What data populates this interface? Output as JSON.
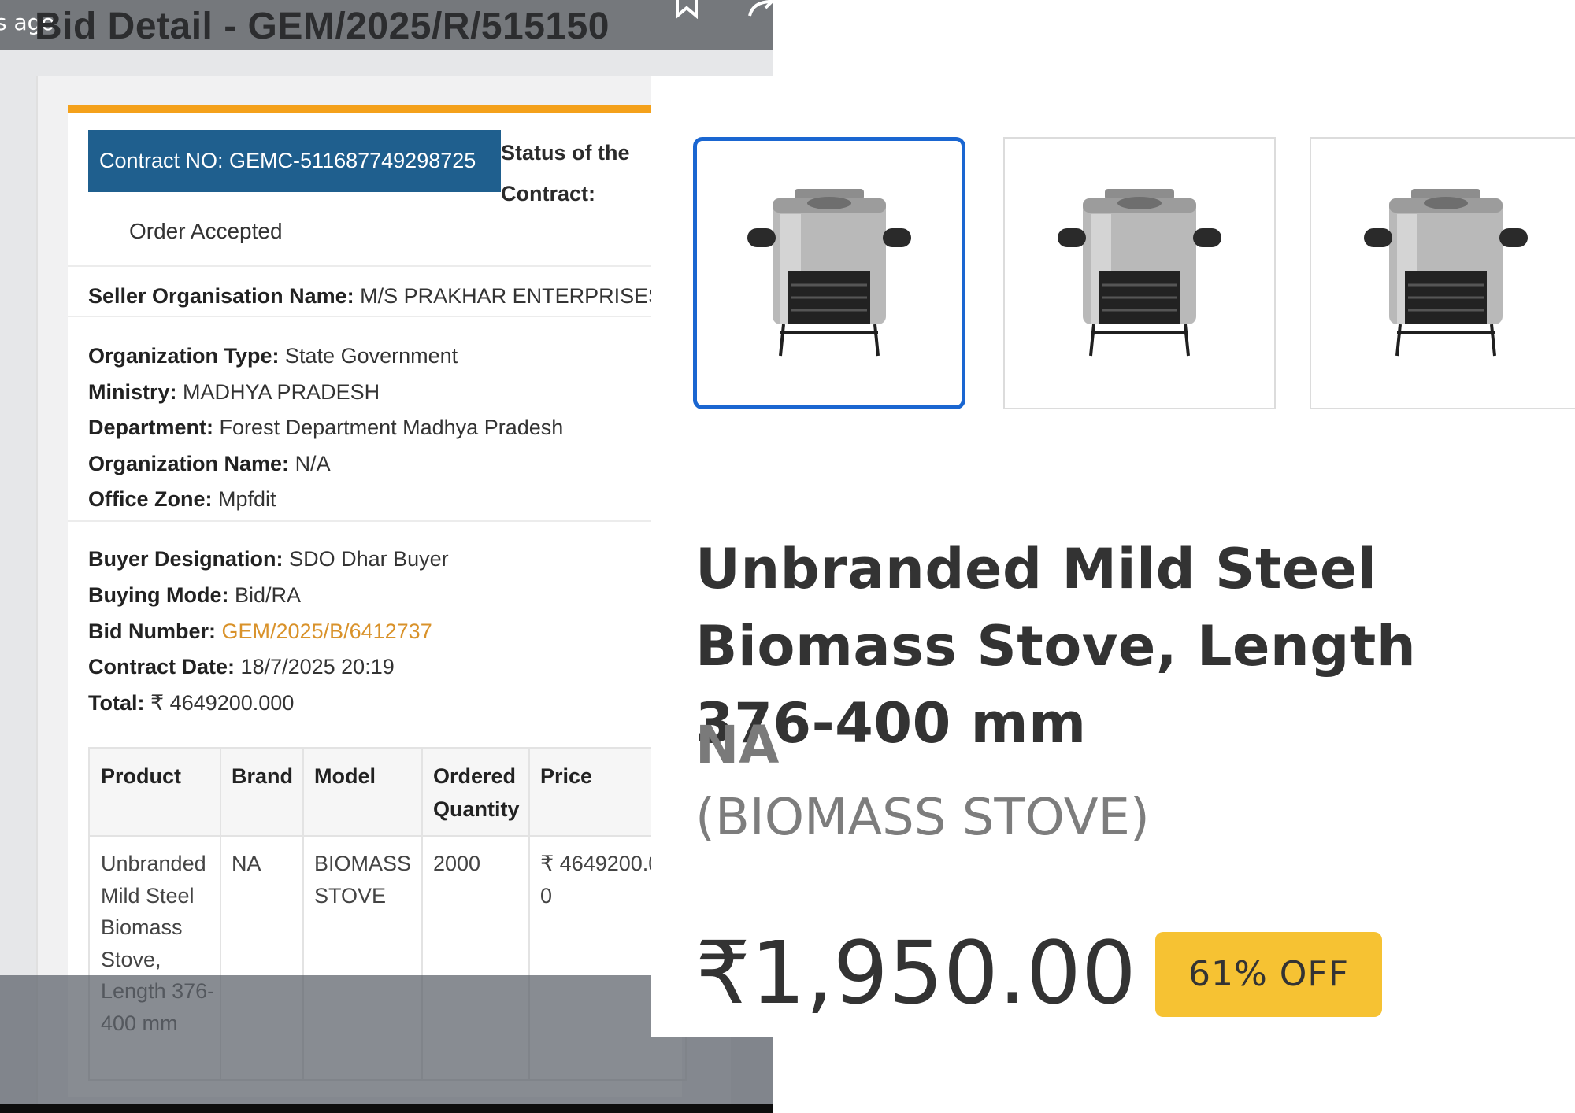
{
  "header": {
    "time_ago": "s ago",
    "title": "Bid Detail - GEM/2025/R/515150"
  },
  "contract": {
    "contract_no": "Contract NO: GEMC-511687749298725",
    "status_label": "Status of the Contract:",
    "status_value": "Order Accepted"
  },
  "seller": {
    "label": "Seller Organisation Name:",
    "value": "M/S PRAKHAR ENTERPRISES"
  },
  "organization": [
    {
      "label": "Organization Type:",
      "value": "State Government"
    },
    {
      "label": "Ministry:",
      "value": "MADHYA PRADESH"
    },
    {
      "label": "Department:",
      "value": "Forest Department Madhya Pradesh"
    },
    {
      "label": "Organization Name:",
      "value": "N/A"
    },
    {
      "label": "Office Zone:",
      "value": "Mpfdit"
    }
  ],
  "buyer": [
    {
      "label": "Buyer Designation:",
      "value": "SDO Dhar Buyer"
    },
    {
      "label": "Buying Mode:",
      "value": "Bid/RA"
    },
    {
      "label": "Bid Number:",
      "value": "GEM/2025/B/6412737"
    },
    {
      "label": "Contract Date:",
      "value": "18/7/2025 20:19"
    },
    {
      "label": "Total:",
      "value": "₹ 4649200.000"
    }
  ],
  "table": {
    "headers": [
      "Product",
      "Brand",
      "Model",
      "Ordered Quantity",
      "Price"
    ],
    "row": {
      "product": "Unbranded Mild Steel Biomass Stove, Length 376-400 mm",
      "brand": "NA",
      "model": "BIOMASS STOVE",
      "quantity": "2000",
      "price": "₹ 4649200.00"
    }
  },
  "product_page": {
    "title": "Unbranded Mild Steel Biomass Stove, Length 376-400 mm",
    "brand": "NA",
    "model": "(BIOMASS STOVE)",
    "price": "₹1,950.00",
    "discount": "61% OFF",
    "selected_thumb": 0
  },
  "colors": {
    "accent_orange": "#f4a11b",
    "contract_blue": "#1f5f8e",
    "link_orange": "#d9922a",
    "thumb_selected": "#1a66d1",
    "badge_yellow": "#f6c233"
  }
}
